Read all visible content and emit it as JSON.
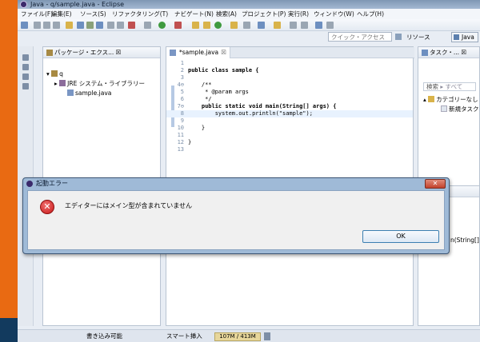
{
  "window": {
    "title": "Java - q/sample.java - Eclipse"
  },
  "menu": [
    "ファイル(F)",
    "編集(E)",
    "ソース(S)",
    "リファクタリング(T)",
    "ナビゲート(N)",
    "検索(A)",
    "プロジェクト(P)",
    "実行(R)",
    "ウィンドウ(W)",
    "ヘルプ(H)"
  ],
  "quick_access": {
    "placeholder": "クイック・アクセス"
  },
  "perspectives": {
    "resource": "リソース",
    "java": "Java"
  },
  "package_explorer": {
    "title": "パッケージ・エクス...",
    "tab_close": "☒",
    "project": "q",
    "library": "JRE システム・ライブラリー",
    "file": "sample.java"
  },
  "editor": {
    "tab_label": "*sample.java",
    "tab_close": "☒",
    "lines": [
      {
        "n": "1",
        "text": ""
      },
      {
        "n": "2",
        "text": "public class sample {"
      },
      {
        "n": "3",
        "text": ""
      },
      {
        "n": "4⊖",
        "text": "    /**"
      },
      {
        "n": "5",
        "text": "     * @param args"
      },
      {
        "n": "6",
        "text": "     */"
      },
      {
        "n": "7⊖",
        "text": "    public static void main(String[] args) {"
      },
      {
        "n": "8",
        "text": "        system.out.println(\"sample\");"
      },
      {
        "n": "9",
        "text": ""
      },
      {
        "n": "10",
        "text": "    }"
      },
      {
        "n": "11",
        "text": ""
      },
      {
        "n": "12",
        "text": "}"
      },
      {
        "n": "13",
        "text": ""
      }
    ]
  },
  "task_pane": {
    "title": "タスク・...",
    "tab_close": "☒",
    "search": "検索",
    "all": "▸ すべて",
    "category": "カテゴリーなし",
    "new_task": "新規タスク"
  },
  "outline_pane": {
    "fragment": "n(String[]"
  },
  "status": {
    "writable": "書き込み可能",
    "insert": "スマート挿入",
    "heap": "107M / 413M"
  },
  "dialog": {
    "title": "起動エラー",
    "close": "✕",
    "error_symbol": "✕",
    "message": "エディターにはメイン型が含まれていません",
    "ok": "OK"
  }
}
